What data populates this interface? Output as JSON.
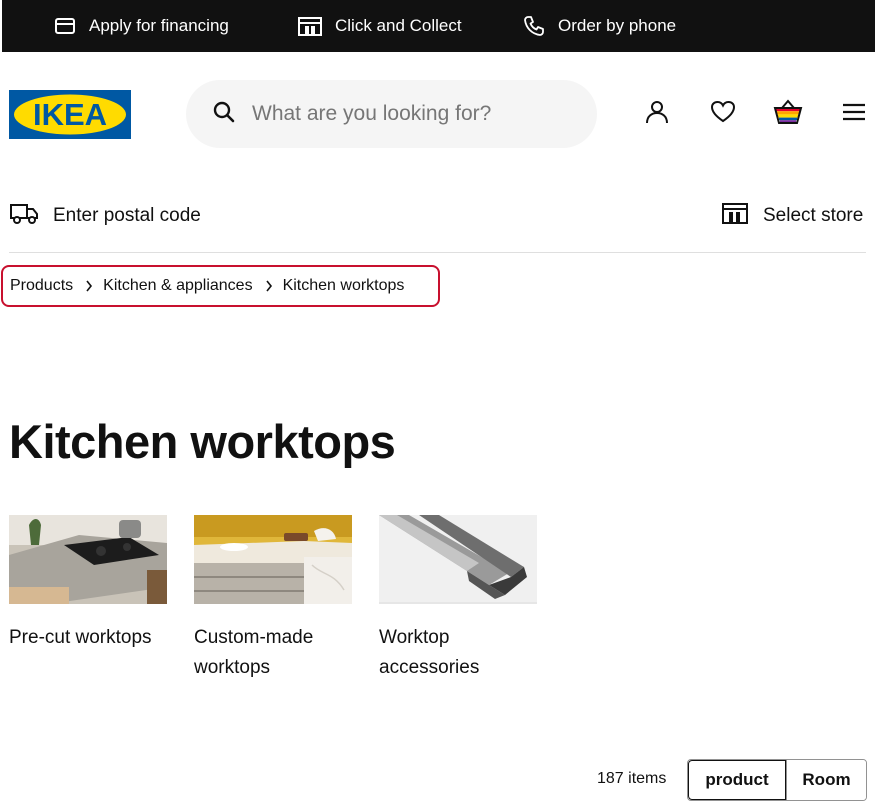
{
  "topbar": {
    "financing": "Apply for financing",
    "collect": "Click and Collect",
    "phone": "Order by phone"
  },
  "header": {
    "logo_text": "IKEA",
    "search_placeholder": "What are you looking for?"
  },
  "delivery": {
    "postal": "Enter postal code",
    "store": "Select store"
  },
  "breadcrumb": {
    "items": [
      "Products",
      "Kitchen & appliances",
      "Kitchen worktops"
    ]
  },
  "page": {
    "title": "Kitchen worktops"
  },
  "categories": [
    {
      "label": "Pre-cut worktops"
    },
    {
      "label": "Custom-made worktops"
    },
    {
      "label": "Worktop accessories"
    }
  ],
  "results": {
    "count": "187 items",
    "toggle_product": "product",
    "toggle_room": "Room"
  },
  "colors": {
    "ikea_blue": "#0058a3",
    "ikea_yellow": "#ffdb00",
    "highlight": "#c8102e"
  }
}
